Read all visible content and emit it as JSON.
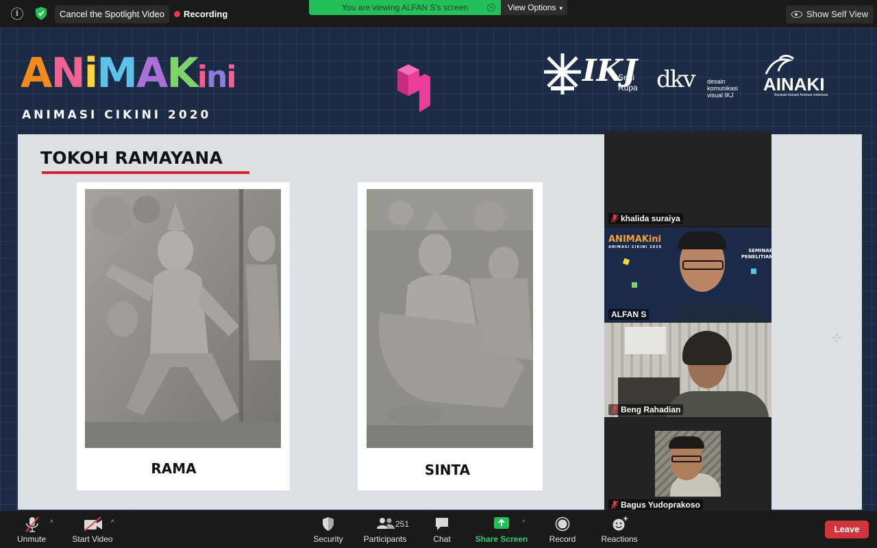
{
  "top_bar": {
    "spotlight_button": "Cancel the Spotlight Video",
    "recording_label": "Recording",
    "viewing_banner": "You are viewing ALFAN S's screen",
    "view_options": "View Options",
    "self_view": "Show Self View"
  },
  "shared_screen": {
    "logo": {
      "main": "ANIMAKini",
      "sub": "ANIMASI CIKINI 2020"
    },
    "partners": {
      "ikj": {
        "mark": "IKJ",
        "text": "Seni\nRupa"
      },
      "dkv": {
        "mark": "dkv",
        "text": "desain\nkomunikasi\nvisual IKJ"
      },
      "ainaki": {
        "mark": "AINAKI",
        "text": "Asosiasi Industri Animasi Indonesia"
      }
    },
    "slide": {
      "title": "TOKOH RAMAYANA",
      "cards": [
        {
          "caption": "RAMA"
        },
        {
          "caption": "SINTA"
        }
      ]
    }
  },
  "participants": [
    {
      "name": "khalida suraiya",
      "muted": true
    },
    {
      "name": "ALFAN S",
      "muted": false,
      "background_text": {
        "logo": "ANIMAKini",
        "sub": "ANIMASI CIKINI 2020",
        "caption": "SEMINAR\nPENELITIAN"
      }
    },
    {
      "name": "Beng Rahadian",
      "muted": true,
      "active_speaker": true
    },
    {
      "name": "Bagus Yudoprakoso",
      "muted": true
    }
  ],
  "toolbar": {
    "unmute": "Unmute",
    "start_video": "Start Video",
    "security": "Security",
    "participants": "Participants",
    "participants_count": "251",
    "chat": "Chat",
    "share_screen": "Share Screen",
    "record": "Record",
    "reactions": "Reactions",
    "leave": "Leave"
  },
  "colors": {
    "accent_green": "#23c05a",
    "recording_red": "#e8394a",
    "leave_red": "#d1343b",
    "active_speaker": "#d8e070",
    "slide_title_underline": "#d3242a"
  }
}
